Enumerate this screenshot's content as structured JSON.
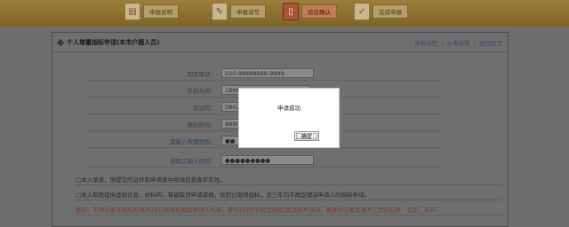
{
  "steps": [
    {
      "label": "申报说明",
      "icon": "document-icon"
    },
    {
      "label": "申报填写",
      "icon": "pencil-icon"
    },
    {
      "label": "验证确认",
      "icon": "phone-icon"
    },
    {
      "label": "完成申报",
      "icon": "checkmark-icon"
    }
  ],
  "panel": {
    "title": "个人增量指标申请(本市户籍人员)",
    "links": [
      "申报流程",
      "办事指南",
      "返回首页"
    ],
    "link_separator": "|"
  },
  "form": {
    "rows": [
      {
        "label": "固定电话：",
        "value": "020-88888888-9999"
      },
      {
        "label": "手机号码：",
        "value": "1866"
      },
      {
        "label": "验证码：",
        "value": "0802"
      },
      {
        "label": "随机密码：",
        "value": "8890"
      },
      {
        "label": "请输入申请密码：",
        "value": "●●"
      },
      {
        "label": "请再次输入密码：",
        "value": "●●●●●●●●●"
      }
    ]
  },
  "notes": [
    "□本人承诺，所提交的证件和申请表中所填信息真实有效。",
    "□本人知悉提供虚假信息、材料的，将被取消申请资格，收回已取得指标，且三年内不再受理该申请人的指标申请。",
    "提示：市中小客车指标办每月26日将随机摇取申请人代表，参与26日(节假日顺延)现场摇号活动，确保中小客车摇号工作的公开、公正、公开。"
  ],
  "dialog": {
    "message": "申请成功",
    "ok_label": "确定"
  }
}
